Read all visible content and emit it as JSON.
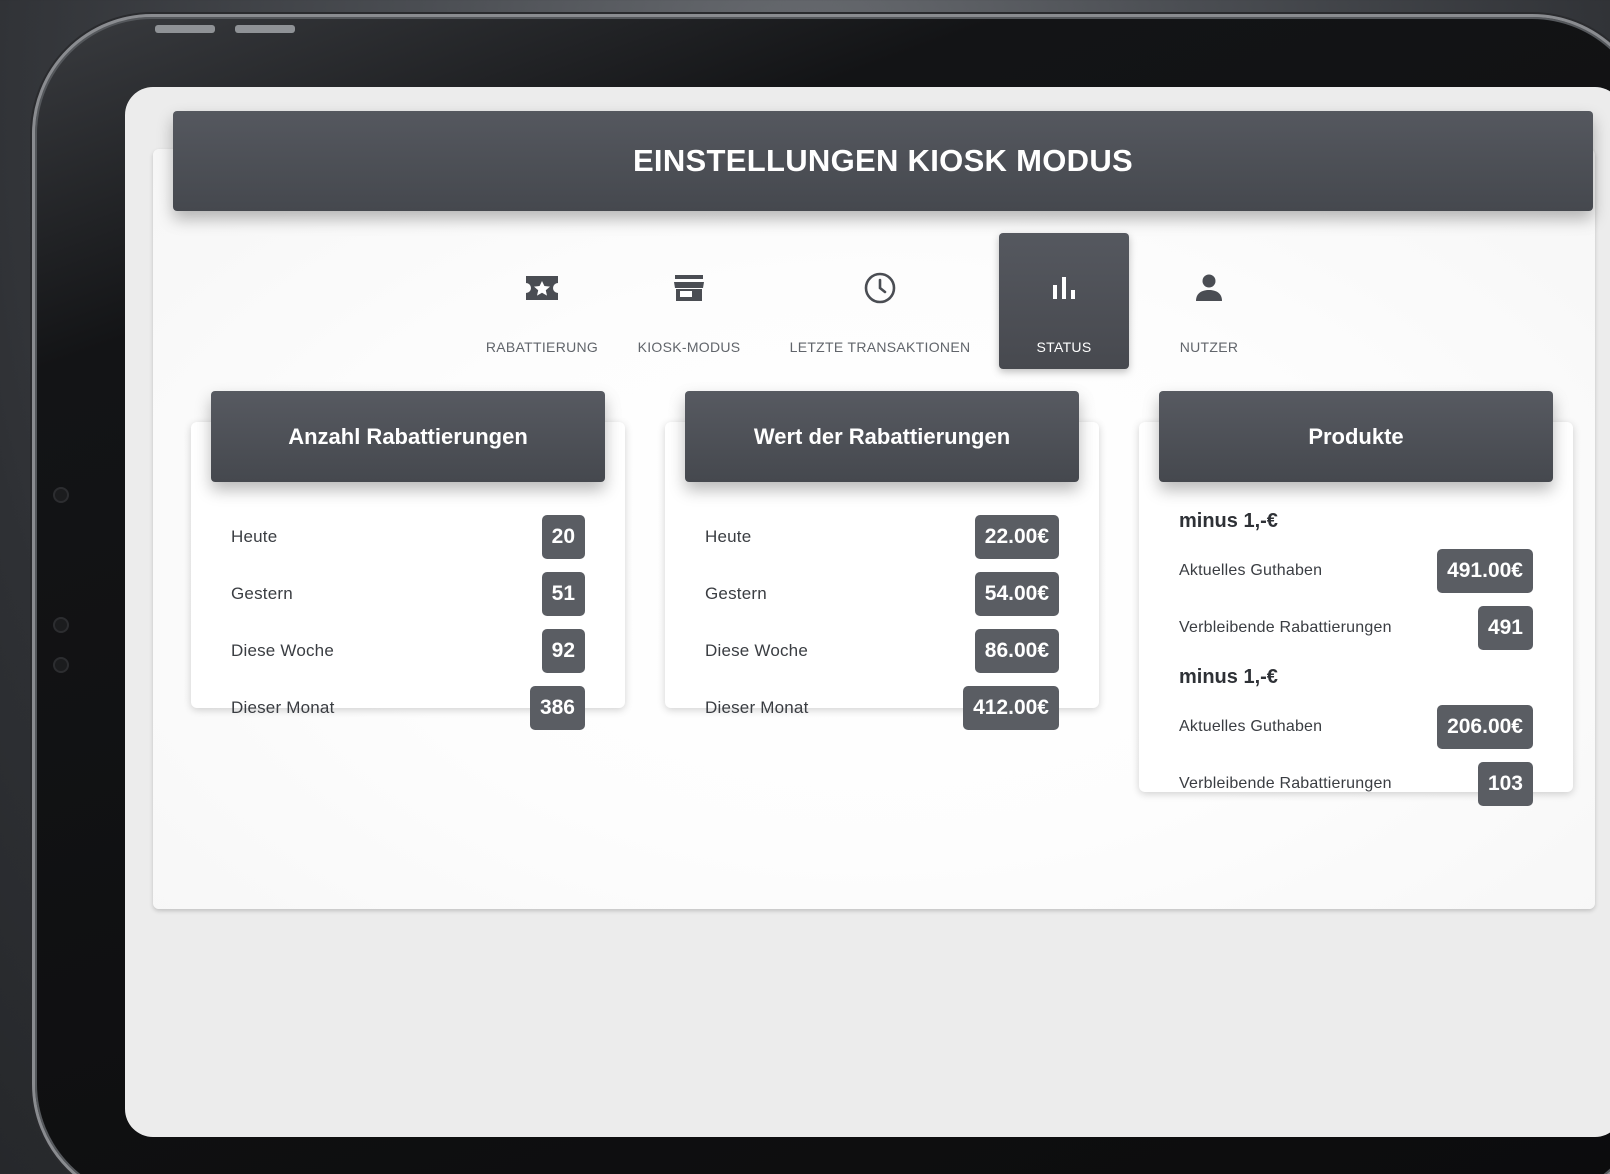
{
  "header": {
    "title": "EINSTELLUNGEN KIOSK MODUS"
  },
  "tabs": [
    {
      "label": "RABATTIERUNG",
      "icon": "ticket-star-icon",
      "active": false
    },
    {
      "label": "KIOSK-MODUS",
      "icon": "store-icon",
      "active": false
    },
    {
      "label": "LETZTE TRANSAKTIONEN",
      "icon": "clock-icon",
      "active": false
    },
    {
      "label": "STATUS",
      "icon": "bar-chart-icon",
      "active": true
    },
    {
      "label": "NUTZER",
      "icon": "person-icon",
      "active": false
    }
  ],
  "anzahl": {
    "title": "Anzahl Rabattierungen",
    "rows": [
      {
        "label": "Heute",
        "value": "20"
      },
      {
        "label": "Gestern",
        "value": "51"
      },
      {
        "label": "Diese Woche",
        "value": "92"
      },
      {
        "label": "Dieser Monat",
        "value": "386"
      }
    ]
  },
  "wert": {
    "title": "Wert der Rabattierungen",
    "rows": [
      {
        "label": "Heute",
        "value": "22.00€"
      },
      {
        "label": "Gestern",
        "value": "54.00€"
      },
      {
        "label": "Diese Woche",
        "value": "86.00€"
      },
      {
        "label": "Dieser Monat",
        "value": "412.00€"
      }
    ]
  },
  "produkte": {
    "title": "Produkte",
    "items": [
      {
        "name": "minus 1,-€",
        "guthaben_label": "Aktuelles Guthaben",
        "guthaben": "491.00€",
        "rest_label": "Verbleibende Rabattierungen",
        "rest": "491"
      },
      {
        "name": "minus 1,-€",
        "guthaben_label": "Aktuelles Guthaben",
        "guthaben": "206.00€",
        "rest_label": "Verbleibende Rabattierungen",
        "rest": "103"
      }
    ]
  },
  "colors": {
    "header_bg": "#4e5157",
    "badge_bg": "#5a5d63",
    "screen_bg": "#ececec"
  }
}
